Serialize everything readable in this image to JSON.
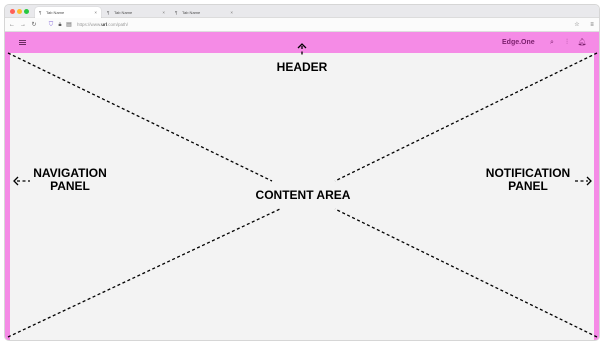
{
  "browser": {
    "tabs": [
      {
        "label": "Tab Name",
        "active": true
      },
      {
        "label": "Tab Name",
        "active": false
      },
      {
        "label": "Tab Name",
        "active": false
      }
    ],
    "url": {
      "prefix": "https://www.",
      "domain": "url",
      "suffix": ".com/path/"
    }
  },
  "header": {
    "brand": "Edge.One",
    "icons": [
      "search-icon",
      "sliders-icon",
      "bell-icon"
    ],
    "color": "#f58be6"
  },
  "annotations": {
    "header": "HEADER",
    "navigation": [
      "NAVIGATION",
      "PANEL"
    ],
    "notification": [
      "NOTIFICATION",
      "PANEL"
    ],
    "content": "CONTENT AREA"
  }
}
